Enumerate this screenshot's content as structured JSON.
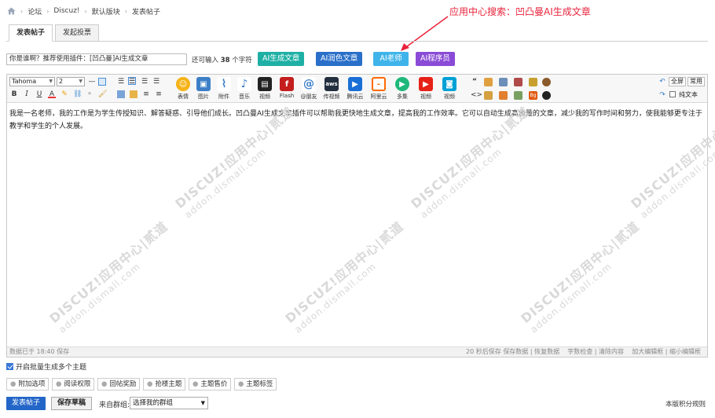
{
  "breadcrumb": [
    "论坛",
    "Discuz!",
    "默认版块",
    "发表帖子"
  ],
  "annotation": "应用中心搜索：凹凸曼AI生成文章",
  "tabs": [
    "发表帖子",
    "发起投票"
  ],
  "title_input": {
    "value": "你是谁啊？推荐使用插件：[凹凸曼]AI生成文章"
  },
  "remaining": {
    "prefix": "还可输入",
    "count": "38",
    "suffix": "个字符"
  },
  "ai_buttons": [
    {
      "label": "AI生成文章",
      "color": "#1fb0a5"
    },
    {
      "label": "AI润色文章",
      "color": "#2a6fc9"
    },
    {
      "label": "AI老师",
      "color": "#3fb4ea"
    },
    {
      "label": "AI程序员",
      "color": "#8a4bd6"
    }
  ],
  "toolbar": {
    "font": "Tahoma",
    "size": "2",
    "big_icons": [
      "表情",
      "图片",
      "附件",
      "音乐",
      "视频",
      "Flash",
      "@朋友",
      "传视频",
      "腾讯云",
      "阿里云",
      "多集",
      "视频",
      "视频"
    ],
    "full_label": "全屏",
    "common_label": "常用",
    "plain_label": "纯文本"
  },
  "content": "我是一名老师，我的工作是为学生传授知识、解答疑惑、引导他们成长。凹凸曼AI生成文章插件可以帮助我更快地生成文章，提高我的工作效率。它可以自动生成高质量的文章，减少我的写作时间和努力，使我能够更专注于教学和学生的个人发展。",
  "watermark": {
    "main": "DISCUZ!应用中心|贰道",
    "sub": "addon.dismall.com"
  },
  "statusbar": {
    "left": "数据已于 18:40 保存",
    "autosave": "20 秒后保存",
    "links": [
      "保存数据",
      "恢复数据",
      "字数检查",
      "清除内容",
      "加大编辑框",
      "缩小编辑框"
    ]
  },
  "batch_label": "开启批量生成多个主题",
  "options": [
    "附加选项",
    "阅读权限",
    "回帖奖励",
    "抢楼主题",
    "主题售价",
    "主题标签"
  ],
  "actions": {
    "post": "发表帖子",
    "draft": "保存草稿",
    "group_label": "来自群组:",
    "group_select": "选择我的群组",
    "rules": "本版积分规则"
  }
}
